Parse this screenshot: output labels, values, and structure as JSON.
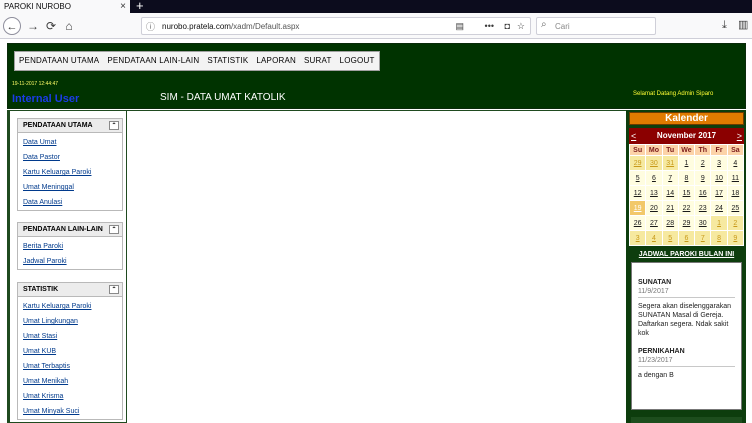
{
  "browser": {
    "tab_title": "PAROKI NUROBO",
    "tab_close": "×",
    "new_tab": "+",
    "url_domain": "nurobo.pratela.com",
    "url_path": "/xadm/Default.aspx",
    "search_placeholder": "Cari"
  },
  "header": {
    "menu": [
      "PENDATAAN UTAMA",
      "PENDATAAN LAIN-LAIN",
      "STATISTIK",
      "LAPORAN",
      "SURAT",
      "LOGOUT"
    ],
    "datetime": "19-11-2017 12:44:47",
    "user_label": "Internal User",
    "title": "SIM - DATA UMAT KATOLIK",
    "welcome": "Selamat Datang Admin Siparo"
  },
  "sidebar": {
    "sections": [
      {
        "title": "PENDATAAN UTAMA",
        "links": [
          "Data Umat",
          "Data Pastor",
          "Kartu Keluarga Paroki",
          "Umat Meninggal",
          "Data Anulasi"
        ]
      },
      {
        "title": "PENDATAAN LAIN-LAIN",
        "links": [
          "Berita Paroki",
          "Jadwal Paroki"
        ]
      },
      {
        "title": "STATISTIK",
        "links": [
          "Kartu Keluarga Paroki",
          "Umat Lingkungan",
          "Umat Stasi",
          "Umat KUB",
          "Umat Terbaptis",
          "Umat Menikah",
          "Umat Krisma",
          "Umat Minyak Suci"
        ]
      }
    ]
  },
  "calendar": {
    "title": "Kalender",
    "month": "November 2017",
    "prev": "<",
    "next": ">",
    "days": [
      "Su",
      "Mo",
      "Tu",
      "We",
      "Th",
      "Fr",
      "Sa"
    ],
    "weeks": [
      [
        "29",
        "30",
        "31",
        "1",
        "2",
        "3",
        "4"
      ],
      [
        "5",
        "6",
        "7",
        "8",
        "9",
        "10",
        "11"
      ],
      [
        "12",
        "13",
        "14",
        "15",
        "16",
        "17",
        "18"
      ],
      [
        "19",
        "20",
        "21",
        "22",
        "23",
        "24",
        "25"
      ],
      [
        "26",
        "27",
        "28",
        "29",
        "30",
        "1",
        "2"
      ],
      [
        "3",
        "4",
        "5",
        "6",
        "7",
        "8",
        "9"
      ]
    ]
  },
  "jadwal": {
    "title": "JADWAL PAROKI BULAN INI",
    "events": [
      {
        "title": "SUNATAN",
        "date": "11/9/2017",
        "desc": "Segera akan diselenggarakan SUNATAN Masal di Gereja. Daftarkan segera. Ndak sakit kok"
      },
      {
        "title": "PERNIKAHAN",
        "date": "11/23/2017",
        "desc": "a dengan B"
      }
    ]
  },
  "colors": {
    "header_bg": "#003300",
    "kalender_title": "#e07a00",
    "calendar_head": "#8b0000",
    "link": "#003a8c"
  }
}
